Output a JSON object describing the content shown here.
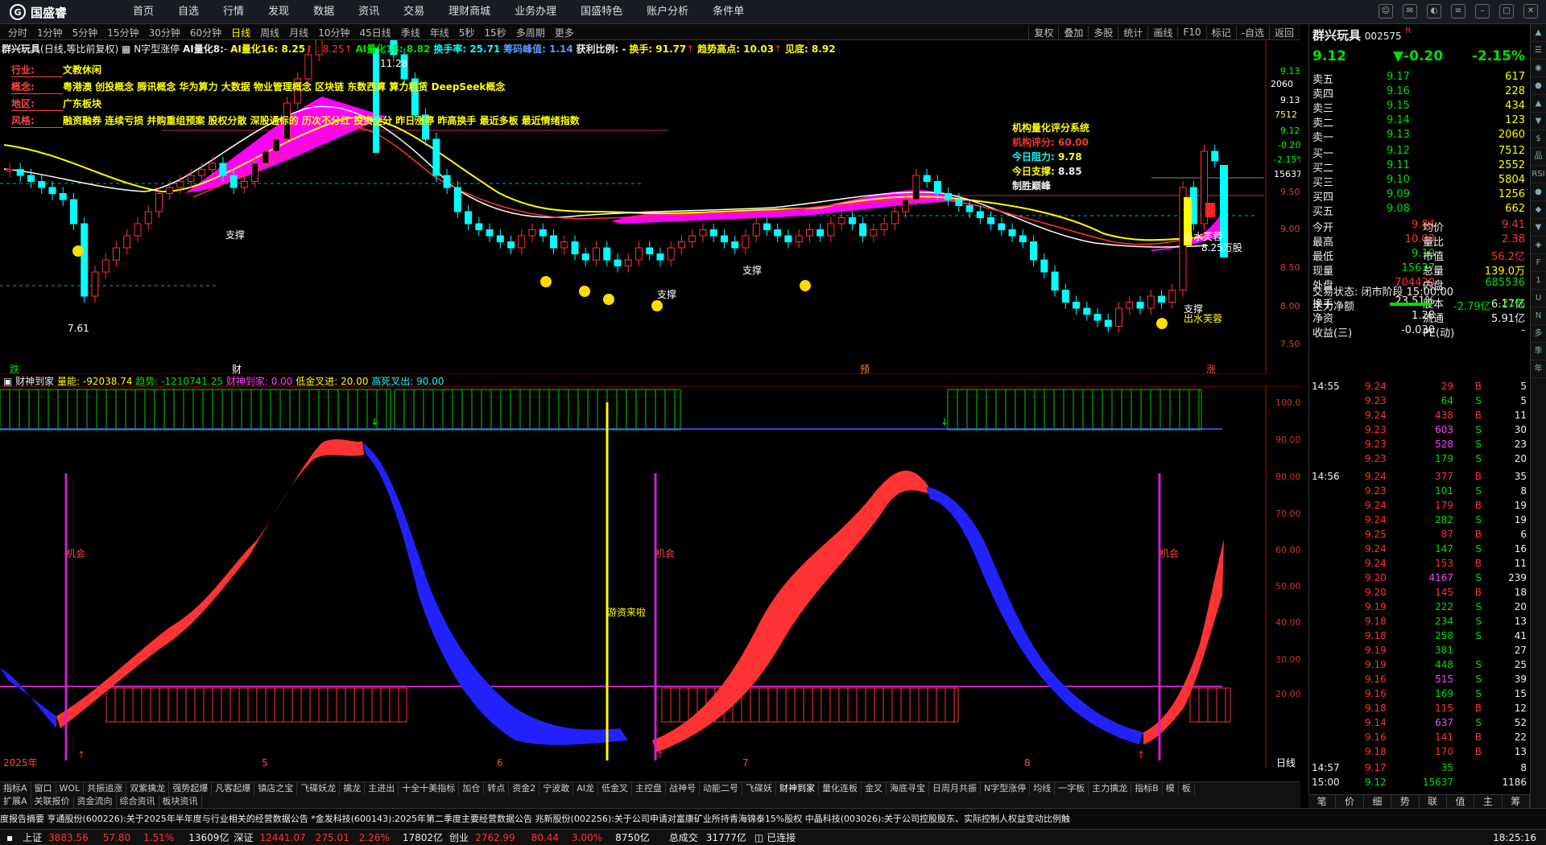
{
  "app": {
    "logo_text": "国盛睿",
    "menu": [
      "首页",
      "自选",
      "行情",
      "发现",
      "数据",
      "资讯",
      "交易",
      "理财商城",
      "业务办理",
      "国盛特色",
      "账户分析",
      "条件单"
    ]
  },
  "periods": [
    "分时",
    "1分钟",
    "5分钟",
    "15分钟",
    "30分钟",
    "60分钟",
    "日线",
    "周线",
    "月线",
    "10分钟",
    "45日线",
    "季线",
    "年线",
    "5秒",
    "15秒",
    "多周期",
    "更多"
  ],
  "active_period": "日线",
  "tools": [
    "复权",
    "叠加",
    "多股",
    "统计",
    "画线",
    "F10",
    "标记",
    "-自选",
    "返回"
  ],
  "info": {
    "name": "群兴玩具",
    "mode": "(日线,等比前复权)",
    "l1": "N字型涨停",
    "l2": "AI量化8:",
    "v2": "- ",
    "l3": "AI量化16: 8.25",
    "v3": "↑ : 8.25↑",
    "l4": "AI量化18: 8.82",
    "l5": "换手率: 25.71",
    "l6": "筹码峰值: 1.14",
    "l7": "获利比例: -",
    "l8": "换手: 91.77",
    "v8": "↑",
    "l9": "趋势高点: 10.03",
    "v9": "↑",
    "l10": "见底: 8.92"
  },
  "tags": [
    {
      "k": "行业:",
      "v": "文教休闲"
    },
    {
      "k": "概念:",
      "v": "粤港澳 创投概念 腾讯概念 华为算力 大数据 物业管理概念 区块链 东数西算 算力租赁 DeepSeek概念"
    },
    {
      "k": "地区:",
      "v": "广东板块"
    },
    {
      "k": "风格:",
      "v": "融资融券 连续亏损 并购重组预案 股权分散 深股通标的 历次不分红 投资全分 昨日涨停 昨高换手 最近多板 最近情绪指数"
    }
  ],
  "rating": {
    "title": "机构量化评分系统",
    "score_l": "机构评分:",
    "score": "60.00",
    "res_l": "今日阻力:",
    "res": "9.78",
    "sup_l": "今日支撑:",
    "sup": "8.85",
    "tip": "制胜巅峰"
  },
  "main_labels": {
    "high": "11.28",
    "low": "7.61",
    "support": "支撑",
    "support2": "支撑",
    "support3": "支撑",
    "support4": "支撑",
    "out1": "出水芙蓉",
    "out2": "出水芙蓉",
    "buy": "8.25万股",
    "mk1": "跌",
    "mk2": "财",
    "mk3": "预",
    "mk4": "涨"
  },
  "price_axis": [
    "2060",
    "9.13",
    "7512",
    "9.12",
    "-0.20",
    "-2.15%",
    "15637",
    "9.50",
    "9.00",
    "8.50",
    "8.00",
    "7.50",
    "9.13"
  ],
  "ind": {
    "name": "财神到家",
    "l1": "量能: -92038.74",
    "l2": "趋势: -1210741.25",
    "l3": "财神到家: 0.00",
    "l4": "低金叉进: 20.00",
    "l5": "高死叉出: 90.00",
    "chance": "机会",
    "chance2": "机会",
    "chance3": "机会",
    "youzi": "游资来啦"
  },
  "ind_axis": [
    "100.0",
    "90.00",
    "80.00",
    "70.00",
    "60.00",
    "50.00",
    "40.00",
    "30.00",
    "20.00"
  ],
  "x_axis": [
    "2025年",
    "5",
    "6",
    "7",
    "8"
  ],
  "x_period": "日线",
  "bottom_tabs": [
    "指标A",
    "窗口",
    "WOL",
    "共振追涨",
    "双紫擒龙",
    "强势起爆",
    "凡客起爆",
    "镇店之宝",
    "飞碟妖龙",
    "擒龙",
    "主进出",
    "十全十美指标",
    "加仓",
    "转点",
    "资金2",
    "宁波敢",
    "AI龙",
    "低金叉",
    "主控盘",
    "战神号",
    "动能二号",
    "飞碟妖",
    "财神到家",
    "量化连板",
    "金叉",
    "海底寻宝",
    "日周月共振",
    "N字型涨停",
    "均线",
    "一字板",
    "主力擒龙",
    "指标B",
    "模",
    "板"
  ],
  "bottom_tabs2": [
    "扩展A",
    "关联报价",
    "资金流向",
    "综合资讯",
    "板块资讯"
  ],
  "ticker": "度报告摘要    亨通股份(600226):关于2025年半年度与行业相关的经营数据公告        *金发科技(600143):2025年第二季度主要经营数据公告        兆新股份(002256):关于公司申请对富康矿业所持青海锦泰15%股权        中晶科技(003026):关于公司控股股东、实际控制人权益变动比例触",
  "status": {
    "sh_l": "上证",
    "sh": "3883.56",
    "sh_c": "57.80",
    "sh_p": "1.51%",
    "sh_v": "13609亿",
    "sz_l": "深证",
    "sz": "12441.07",
    "sz_c": "275.01",
    "sz_p": "2.26%",
    "sz_v": "17802亿",
    "cy_l": "创业",
    "cy": "2762.99",
    "cy_c": "80.44",
    "cy_p": "3.00%",
    "cy_v": "8750亿",
    "tot_l": "总成交",
    "tot": "31777亿",
    "conn": "已连接",
    "time": "18:25:16"
  },
  "rp": {
    "name": "群兴玩具",
    "code": "002575",
    "flag": "R",
    "price": "9.12",
    "chg": "▼-0.20",
    "pct": "-2.15%",
    "asks": [
      {
        "l": "卖五",
        "p": "9.17",
        "v": "617"
      },
      {
        "l": "卖四",
        "p": "9.16",
        "v": "228"
      },
      {
        "l": "卖三",
        "p": "9.15",
        "v": "434"
      },
      {
        "l": "卖二",
        "p": "9.14",
        "v": "123"
      },
      {
        "l": "卖一",
        "p": "9.13",
        "v": "2060"
      }
    ],
    "bids": [
      {
        "l": "买一",
        "p": "9.12",
        "v": "7512"
      },
      {
        "l": "买二",
        "p": "9.11",
        "v": "2552"
      },
      {
        "l": "买三",
        "p": "9.10",
        "v": "5804"
      },
      {
        "l": "买四",
        "p": "9.09",
        "v": "1256"
      },
      {
        "l": "买五",
        "p": "9.08",
        "v": "662"
      }
    ],
    "stats": [
      [
        "今开",
        "9.84",
        "均价",
        "9.41"
      ],
      [
        "最高",
        "10.03",
        "量比",
        "2.38"
      ],
      [
        "最低",
        "9.10",
        "市值",
        "56.2亿"
      ],
      [
        "现量",
        "15637",
        "总量",
        "139.0万"
      ],
      [
        "外盘",
        "704420",
        "内盘",
        "685536"
      ],
      [
        "换手",
        "23.51%",
        "股本",
        "6.17亿"
      ],
      [
        "净资",
        "1.28",
        "流通",
        "5.91亿"
      ],
      [
        "收益(三)",
        "-0.030",
        "PE(动)",
        "-"
      ]
    ],
    "state": "交易状态: 闭市阶段 15:00:00",
    "flow_l": "主力净额",
    "flow": "-2.79亿",
    "flow_p": "-21%"
  },
  "trades": [
    [
      "14:55",
      "9.24",
      "29",
      "B",
      "5"
    ],
    [
      "",
      "9.23",
      "64",
      "S",
      "5"
    ],
    [
      "",
      "9.24",
      "438",
      "B",
      "11"
    ],
    [
      "",
      "9.23",
      "603",
      "S",
      "30"
    ],
    [
      "",
      "9.23",
      "528",
      "S",
      "23"
    ],
    [
      "",
      "9.23",
      "179",
      "S",
      "20"
    ],
    [
      "14:56",
      "9.24",
      "377",
      "B",
      "35"
    ],
    [
      "",
      "9.23",
      "101",
      "S",
      "8"
    ],
    [
      "",
      "9.24",
      "179",
      "B",
      "19"
    ],
    [
      "",
      "9.24",
      "282",
      "S",
      "19"
    ],
    [
      "",
      "9.25",
      "87",
      "B",
      "6"
    ],
    [
      "",
      "9.24",
      "147",
      "S",
      "16"
    ],
    [
      "",
      "9.24",
      "153",
      "B",
      "11"
    ],
    [
      "",
      "9.20",
      "4167",
      "S",
      "239"
    ],
    [
      "",
      "9.20",
      "145",
      "B",
      "18"
    ],
    [
      "",
      "9.19",
      "222",
      "S",
      "20"
    ],
    [
      "",
      "9.18",
      "234",
      "S",
      "13"
    ],
    [
      "",
      "9.18",
      "258",
      "S",
      "41"
    ],
    [
      "",
      "9.19",
      "381",
      "",
      "27"
    ],
    [
      "",
      "9.19",
      "448",
      "S",
      "25"
    ],
    [
      "",
      "9.16",
      "515",
      "S",
      "39"
    ],
    [
      "",
      "9.16",
      "169",
      "S",
      "15"
    ],
    [
      "",
      "9.18",
      "115",
      "B",
      "12"
    ],
    [
      "",
      "9.14",
      "637",
      "S",
      "52"
    ],
    [
      "",
      "9.16",
      "141",
      "B",
      "22"
    ],
    [
      "",
      "9.18",
      "170",
      "B",
      "13"
    ],
    [
      "14:57",
      "9.17",
      "35",
      "",
      "8"
    ],
    [
      "15:00",
      "9.12",
      "15637",
      "",
      "1186"
    ]
  ],
  "rp_tabs": [
    "笔",
    "价",
    "细",
    "势",
    "联",
    "值",
    "主",
    "筹"
  ],
  "side_tabs": [
    "▲",
    "☰",
    "◉",
    "●",
    "▲",
    "▼",
    "$",
    "品",
    "RSI",
    "●",
    "◆",
    "▼",
    "◈",
    "F",
    "1",
    "U",
    "N",
    "多",
    "季",
    "年"
  ],
  "colors": {
    "up": "#ff3333",
    "down": "#00e000",
    "ma_yellow": "#ffff00",
    "magenta": "#ff00ff"
  }
}
